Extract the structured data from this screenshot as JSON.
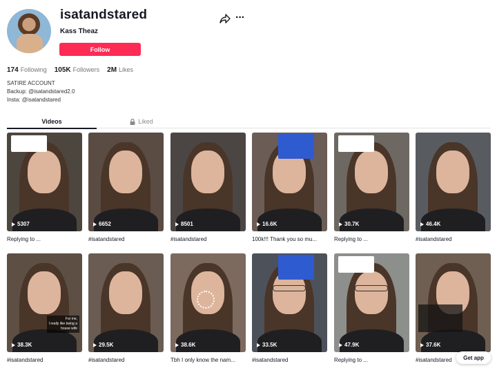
{
  "profile": {
    "username": "isatandstared",
    "nickname": "Kass Theaz",
    "follow_label": "Follow",
    "bio_lines": [
      "SATIRE ACCOUNT",
      "Backup: @isatandstared2.0",
      "Insta: @isatandstared"
    ]
  },
  "stats": {
    "following_count": "174",
    "following_label": "Following",
    "followers_count": "105K",
    "followers_label": "Followers",
    "likes_count": "2M",
    "likes_label": "Likes"
  },
  "tabs": {
    "videos": "Videos",
    "liked": "Liked"
  },
  "videos": [
    {
      "views": "5307",
      "desc": "Replying to ...",
      "bg": "#4d463f"
    },
    {
      "views": "6652",
      "desc": "#isatandstared",
      "bg": "#5a4b43"
    },
    {
      "views": "8501",
      "desc": "#isatandstared",
      "bg": "#4b4644"
    },
    {
      "views": "16.6K",
      "desc": "100k!!! Thank you so mu...",
      "bg": "#6b5d55"
    },
    {
      "views": "30.7K",
      "desc": "Replying to ...",
      "bg": "#6d6862"
    },
    {
      "views": "46.4K",
      "desc": "#isatandstared",
      "bg": "#585c61"
    },
    {
      "views": "38.3K",
      "desc": "#isatandstared",
      "bg": "#5d4f44"
    },
    {
      "views": "29.5K",
      "desc": "#isatandstared",
      "bg": "#6a5c52"
    },
    {
      "views": "38.6K",
      "desc": "Tbh I only know the nam...",
      "bg": "#7d6a5e"
    },
    {
      "views": "33.5K",
      "desc": "#isatandstared",
      "bg": "#4d525a"
    },
    {
      "views": "47.9K",
      "desc": "Replying to ...",
      "bg": "#8c8f8c"
    },
    {
      "views": "37.6K",
      "desc": "#isatandstared",
      "bg": "#6e5f52"
    }
  ],
  "overlays": {
    "wife_text": "For me,\nI really like being a\nhouse wife"
  },
  "get_app": "Get app"
}
